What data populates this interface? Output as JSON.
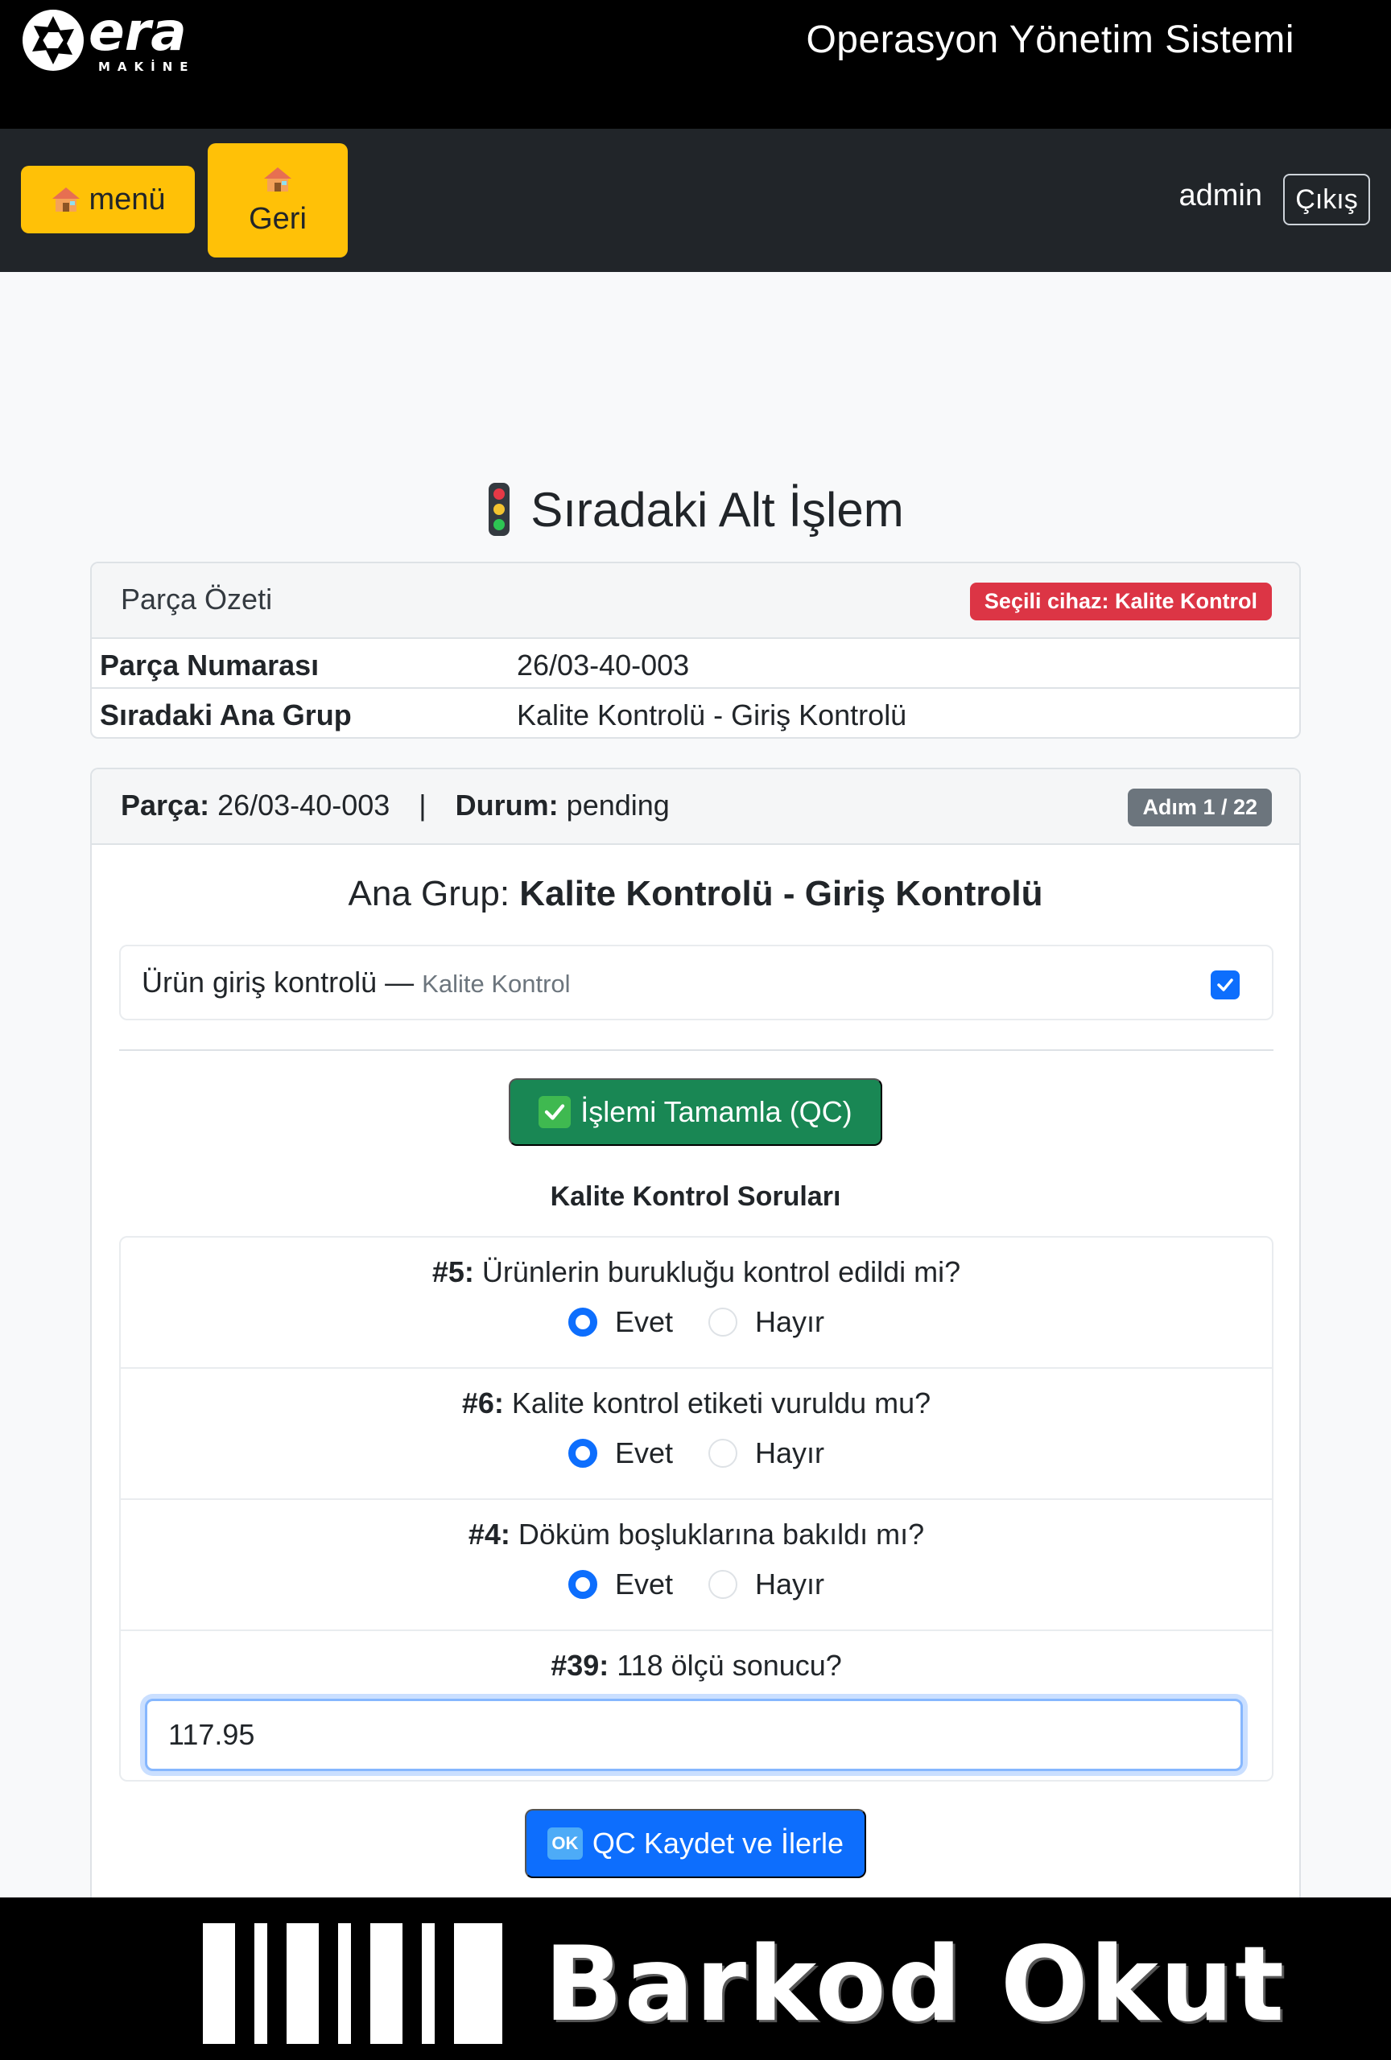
{
  "header": {
    "logo_text": "era",
    "logo_subtext": "MAKİNE",
    "app_title": "Operasyon Yönetim Sistemi"
  },
  "nav": {
    "menu_label": "menü",
    "back_label": "Geri",
    "user": "admin",
    "logout_label": "Çıkış"
  },
  "page": {
    "heading": "Sıradaki Alt İşlem"
  },
  "summary": {
    "title": "Parça Özeti",
    "device_badge": "Seçili cihaz: Kalite Kontrol",
    "rows": [
      {
        "label": "Parça Numarası",
        "value": "26/03-40-003"
      },
      {
        "label": "Sıradaki Ana Grup",
        "value": "Kalite Kontrolü - Giriş Kontrolü"
      }
    ]
  },
  "process": {
    "part_label": "Parça:",
    "part_value": "26/03-40-003",
    "separator": "|",
    "status_label": "Durum:",
    "status_value": "pending",
    "step_badge": "Adım 1 / 22",
    "group_prefix": "Ana Grup:",
    "group_name": "Kalite Kontrolü - Giriş Kontrolü",
    "operation": {
      "name": "Ürün giriş kontrolü",
      "dash": "—",
      "device": "Kalite Kontrol",
      "checked": true
    },
    "complete_button": "İşlemi Tamamla (QC)",
    "qc_title": "Kalite Kontrol Soruları",
    "questions": [
      {
        "num": "#5:",
        "text": "Ürünlerin burukluğu kontrol edildi mi?",
        "options": [
          "Evet",
          "Hayır"
        ],
        "selected": "Evet"
      },
      {
        "num": "#6:",
        "text": "Kalite kontrol etiketi vuruldu mu?",
        "options": [
          "Evet",
          "Hayır"
        ],
        "selected": "Evet"
      },
      {
        "num": "#4:",
        "text": "Döküm boşluklarına bakıldı mı?",
        "options": [
          "Evet",
          "Hayır"
        ],
        "selected": "Evet"
      },
      {
        "num": "#39:",
        "text": "118 ölçü sonucu?",
        "input_value": "117.95"
      }
    ],
    "save_icon": "OK",
    "save_button": "QC Kaydet ve İlerle"
  },
  "footer": {
    "barcode_label": "Barkod Okut"
  },
  "colors": {
    "accent_yellow": "#ffc107",
    "danger": "#dc3545",
    "success": "#198754",
    "primary": "#0d6efd",
    "secondary": "#6c757d"
  }
}
